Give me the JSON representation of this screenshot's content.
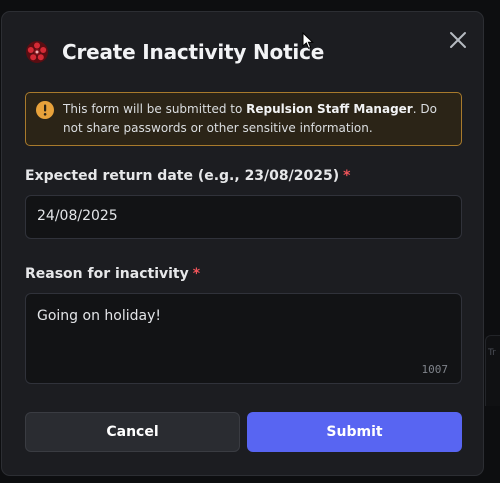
{
  "dialog": {
    "title": "Create Inactivity Notice",
    "close_icon": "close-icon",
    "app_icon": "red-flower-icon"
  },
  "warning": {
    "icon": "warning-icon",
    "text_before": "This form will be submitted to ",
    "app_name": "Repulsion Staff Manager",
    "text_after": ". Do not share passwords or other sensitive information."
  },
  "fields": {
    "return_date": {
      "label": "Expected return date (e.g., 23/08/2025)",
      "required_marker": "*",
      "value": "24/08/2025"
    },
    "reason": {
      "label": "Reason for inactivity",
      "required_marker": "*",
      "value": "Going on holiday!",
      "char_count": "1007"
    }
  },
  "buttons": {
    "cancel": "Cancel",
    "submit": "Submit"
  },
  "background": {
    "fragment_text": "Tr"
  },
  "colors": {
    "accent": "#5865f2",
    "warning_border": "#a87a2c",
    "required": "#f0545a"
  }
}
